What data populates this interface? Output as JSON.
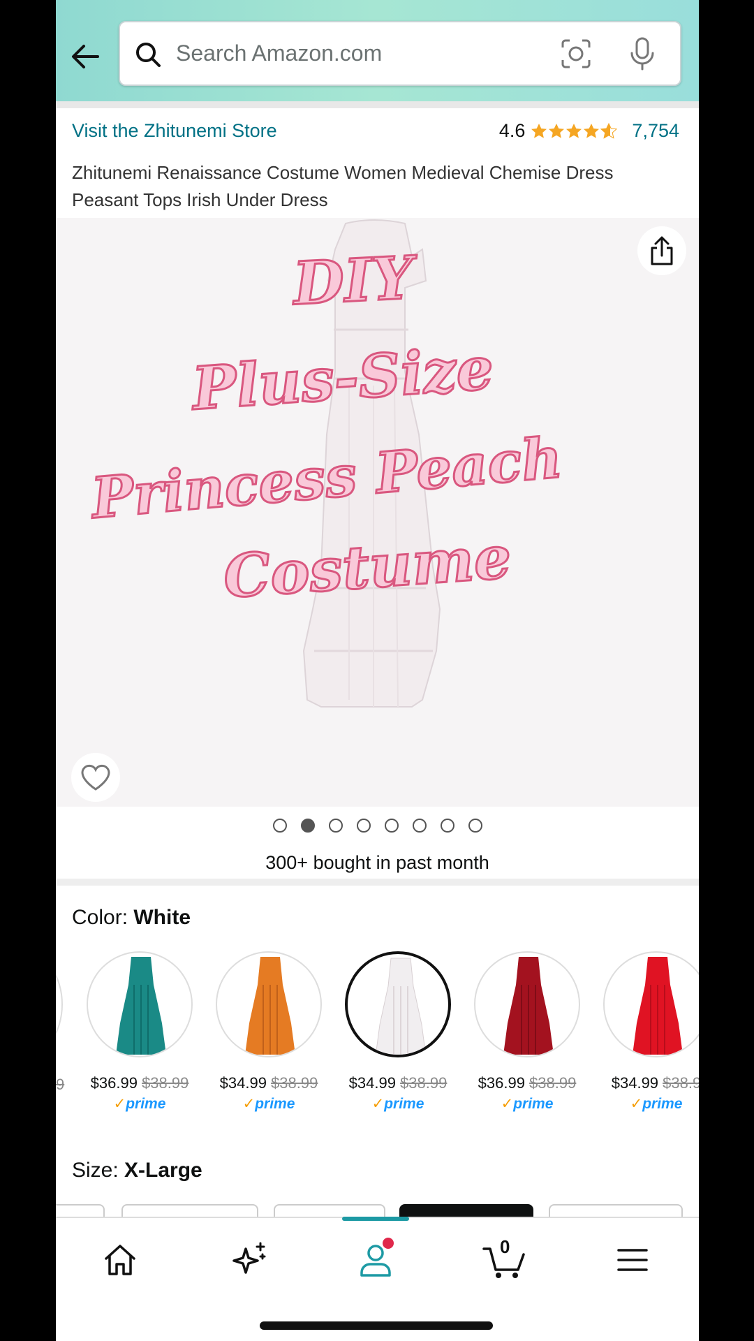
{
  "search": {
    "placeholder": "Search Amazon.com"
  },
  "store": {
    "link": "Visit the Zhitunemi Store",
    "rating": "4.6",
    "reviews": "7,754"
  },
  "product": {
    "title": "Zhitunemi Renaissance Costume Women Medieval Chemise Dress Peasant Tops Irish Under Dress"
  },
  "overlay": {
    "line1": "DIY",
    "line2": "Plus-Size",
    "line3": "Princess Peach",
    "line4": "Costume"
  },
  "gallery": {
    "image_count": 8,
    "active_index": 1
  },
  "bought": "300+ bought in past month",
  "color": {
    "label": "Color: ",
    "value": "White"
  },
  "swatches": [
    {
      "price": "$36.99",
      "old": "$38.99",
      "prime": "prime",
      "color": "#1a8a86"
    },
    {
      "price": "$34.99",
      "old": "$38.99",
      "prime": "prime",
      "color": "#e57b23"
    },
    {
      "price": "$34.99",
      "old": "$38.99",
      "prime": "prime",
      "color": "#f1eef0"
    },
    {
      "price": "$36.99",
      "old": "$38.99",
      "prime": "prime",
      "color": "#a3121f"
    },
    {
      "price": "$34.99",
      "old": "$38.9",
      "prime": "prime",
      "color": "#e01323"
    }
  ],
  "size": {
    "label": "Size: ",
    "value": "X-Large"
  },
  "cart": {
    "count": "0"
  },
  "colors": {
    "link": "#007185",
    "accent": "#1d9aa4",
    "star": "#f5a623",
    "overlay_fill": "#f9c9d9",
    "overlay_stroke": "#d9577f"
  },
  "icons": [
    "back-arrow-icon",
    "search-icon",
    "camera-lens-icon",
    "microphone-icon",
    "share-icon",
    "heart-icon",
    "home-icon",
    "sparkle-icon",
    "account-icon",
    "cart-icon",
    "menu-icon"
  ]
}
